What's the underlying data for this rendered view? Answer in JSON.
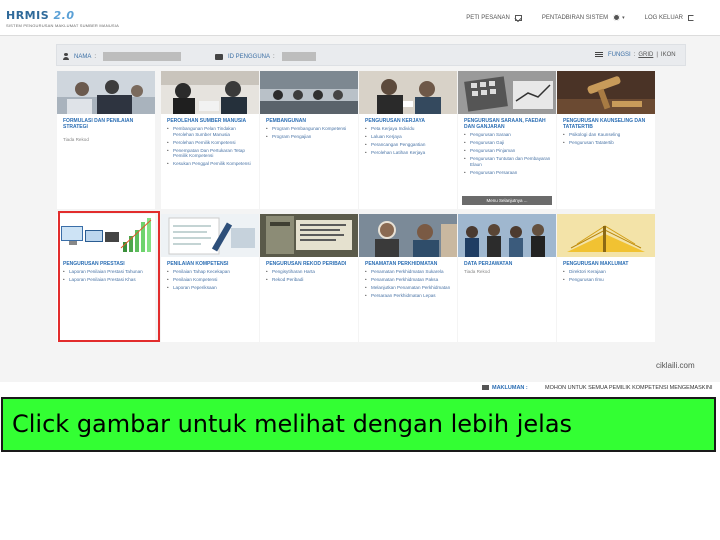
{
  "header": {
    "logo_main": "HRMIS",
    "logo_version": "2.0",
    "logo_sub": "SISTEM PENGURUSAN MAKLUMAT SUMBER MANUSIA",
    "nav": [
      {
        "label": "PETI PESANAN",
        "icon": "mail-icon"
      },
      {
        "label": "PENTADBIRAN SISTEM",
        "icon": "gear-icon"
      },
      {
        "label": "LOG KELUAR",
        "icon": "exit-icon"
      }
    ]
  },
  "user_bar": {
    "name_label": "NAMA",
    "id_label": "ID PENGGUNA",
    "fungsi_label": "FUNGSI",
    "view_grid": "GRID",
    "view_ikon": "IKON"
  },
  "modules": [
    {
      "title": "FORMULASI DAN PENILAIAN STRATEGI",
      "items": [
        "Tiada Rekod"
      ],
      "bullets": false
    },
    {
      "title": "PEROLEHAN SUMBER MANUSIA",
      "items": [
        "Pembangunan Pelan Tindakan Perolehan Sumber Manusia",
        "Perolehan Pemilik Kompetensi",
        "Penempatan Dan Pertukaran Tetap Pemilik Kompetensi",
        "Kesukan Penggal Pemilik Kompetensi"
      ],
      "bullets": true
    },
    {
      "title": "PEMBANGUNAN",
      "items": [
        "Program Pembangunan Kompetensi",
        "Program Pengajian"
      ],
      "bullets": true
    },
    {
      "title": "PENGURUSAN KERJAYA",
      "items": [
        "Peta Kerjaya Individu",
        "Laluan Kerjaya",
        "Perancangan Penggantian",
        "Perolehan Latihan Kerjaya"
      ],
      "bullets": true
    },
    {
      "title": "PENGURUSAN SARAAN, FAEDAH DAN GANJARAN",
      "items": [
        "Pengurusan Saraan",
        "Pengurusan Gaji",
        "Pengurusan Pinjaman",
        "Pengurusan Tuntutan dan Pembayaran Elaun",
        "Pengurusan Persaraan"
      ],
      "bullets": true,
      "more": "Menu Selanjutnya ..."
    },
    {
      "title": "PENGURUSAN KAUNSELING DAN TATATERTIB",
      "items": [
        "Psikologi dan Kaunseling",
        "Pengurusan Tatatertib"
      ],
      "bullets": true
    },
    {
      "title": "PENGURUSAN PRESTASI",
      "items": [
        "Laporan Penilaian Prestasi Tahunan",
        "Laporan Penilaian Prestasi Khas"
      ],
      "bullets": true
    },
    {
      "title": "PENILAIAN KOMPETENSI",
      "items": [
        "Penilaian Tahap Kecekapan",
        "Penilaian Kompetensi",
        "Laporan Peperiksaan"
      ],
      "bullets": true
    },
    {
      "title": "PENGURUSAN REKOD PERIBADI",
      "items": [
        "Pengisytiharan Harta",
        "Rekod Peribadi"
      ],
      "bullets": true
    },
    {
      "title": "PENAMATAN PERKHIDMATAN",
      "items": [
        "Penamatan Perkhidmatan Sukarela",
        "Penamatan Perkhidmatan Paksa",
        "Melanjutkan Penamatan Perkhidmatan",
        "Persaraan Perkhidmatan Lepas"
      ],
      "bullets": true
    },
    {
      "title": "DATA PERJAWATAN",
      "items": [
        "Tiada Rekod"
      ],
      "bullets": false
    },
    {
      "title": "PENGURUSAN MAKLUMAT",
      "items": [
        "Direktori Kerajaan",
        "Pengurusan Ilmu"
      ],
      "bullets": true
    }
  ],
  "footer_brand": "ciklaili.com",
  "ticker": {
    "label": "MAKLUMAN :",
    "text": "MOHON UNTUK SEMUA PEMILIK KOMPETENSI MENGEMASKINI"
  },
  "caption": "Click gambar untuk melihat dengan lebih jelas",
  "colors": {
    "caption_bg": "#33ff33",
    "selection_border": "#e22c2c",
    "link_blue": "#2a6db3"
  }
}
